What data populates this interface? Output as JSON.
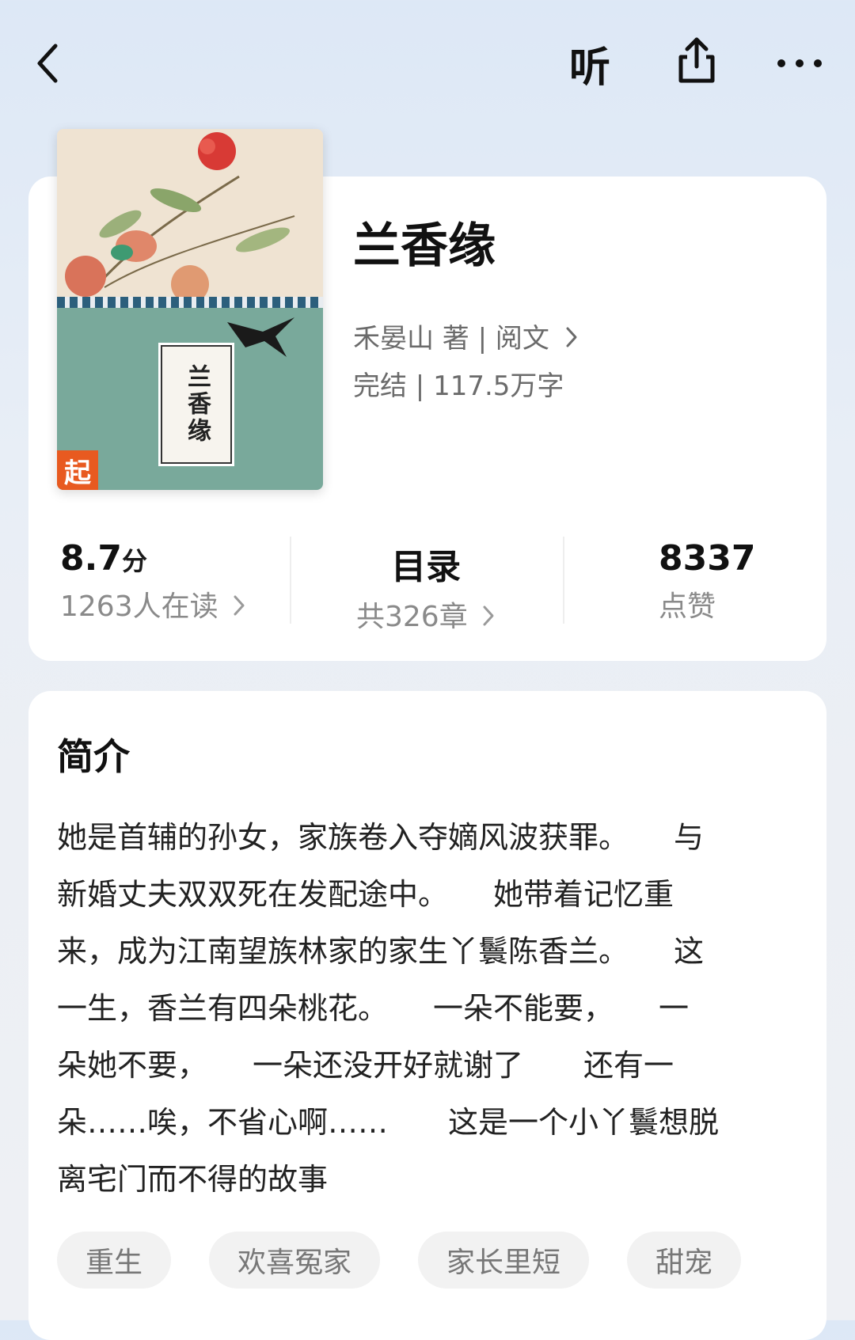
{
  "header": {
    "back_icon": "chevron-left-icon",
    "listen_label": "听",
    "share_icon": "share-icon",
    "more_icon": "more-dots-icon"
  },
  "book": {
    "cover_title": "兰香缘",
    "cover_badge": "起",
    "title": "兰香缘",
    "author_line": "禾晏山 著 | 阅文",
    "status_line": "完结 | 117.5万字"
  },
  "stats": {
    "score": "8.7",
    "score_unit": "分",
    "readers": "1263人在读",
    "catalog_label": "目录",
    "chapters": "共326章",
    "likes": "8337",
    "likes_label": "点赞"
  },
  "intro": {
    "title": "简介",
    "text": "她是首辅的孙女，家族卷入夺嫡风波获罪。　　与\n新婚丈夫双双死在发配途中。　　她带着记忆重\n来，成为江南望族林家的家生丫鬟陈香兰。　　这\n一生，香兰有四朵桃花。　　一朵不能要，　　一\n朵她不要，　　一朵还没开好就谢了　　还有一\n朵……唉，不省心啊……　　这是一个小丫鬟想脱\n离宅门而不得的故事"
  },
  "tags": [
    "重生",
    "欢喜冤家",
    "家长里短",
    "甜宠"
  ]
}
